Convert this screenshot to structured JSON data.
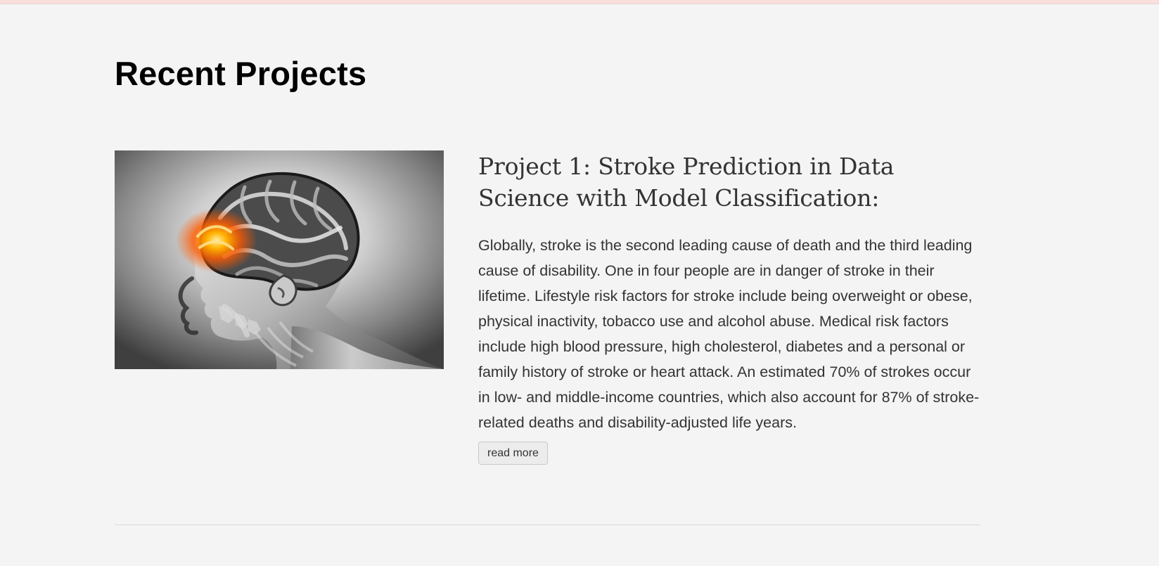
{
  "section": {
    "title": "Recent Projects"
  },
  "projects": [
    {
      "image_icon": "brain-scan-image",
      "title": "Project 1: Stroke Prediction in Data Science with Model Classification:",
      "description": "Globally, stroke is the second leading cause of death and the third leading cause of disability. One in four people are in danger of stroke in their lifetime. Lifestyle risk factors for stroke include being overweight or obese, physical inactivity, tobacco use and alcohol abuse. Medical risk factors include high blood pressure, high cholesterol, diabetes and a personal or family history of stroke or heart attack. An estimated 70% of strokes occur in low- and middle-income countries, which also account for 87% of stroke-related deaths and disability-adjusted life years.",
      "button_label": "read more"
    }
  ],
  "colors": {
    "background": "#f4f4f4",
    "top_strip": "#f8dfdc",
    "text": "#333333",
    "heading": "#000000",
    "divider": "#d9d9d9",
    "button_bg": "#ececec",
    "accent_glow": "#ff8a00"
  }
}
